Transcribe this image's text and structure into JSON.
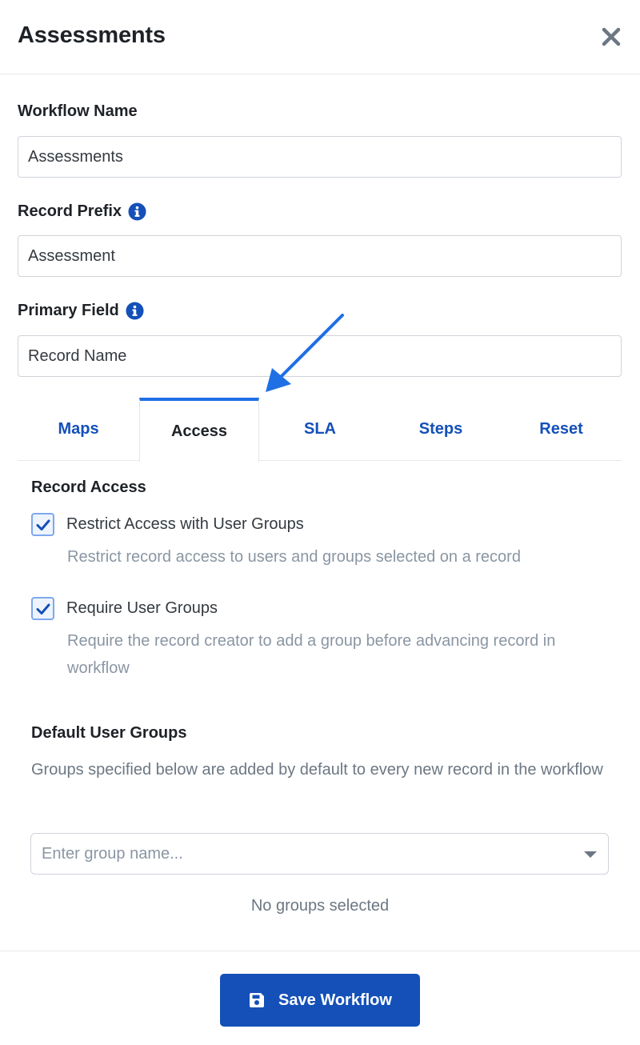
{
  "header": {
    "title": "Assessments",
    "close_icon": "close-icon"
  },
  "form": {
    "workflow_name": {
      "label": "Workflow Name",
      "value": "Assessments"
    },
    "record_prefix": {
      "label": "Record Prefix",
      "value": "Assessment",
      "info_icon": "info-icon"
    },
    "primary_field": {
      "label": "Primary Field",
      "value": "Record Name",
      "info_icon": "info-icon"
    }
  },
  "tabs": [
    {
      "label": "Maps",
      "active": false
    },
    {
      "label": "Access",
      "active": true
    },
    {
      "label": "SLA",
      "active": false
    },
    {
      "label": "Steps",
      "active": false
    },
    {
      "label": "Reset",
      "active": false
    }
  ],
  "access": {
    "section_title": "Record Access",
    "options": [
      {
        "label": "Restrict Access with User Groups",
        "help": "Restrict record access to users and groups selected on a record",
        "checked": true
      },
      {
        "label": "Require User Groups",
        "help": "Require the record creator to add a group before advancing record in workflow",
        "checked": true
      }
    ],
    "default_groups": {
      "title": "Default User Groups",
      "description": "Groups specified below are added by default to every new record in the workflow",
      "placeholder": "Enter group name...",
      "empty_text": "No groups selected"
    }
  },
  "footer": {
    "save_label": "Save Workflow",
    "save_icon": "floppy-disk-icon"
  },
  "colors": {
    "primary": "#1450b8",
    "active_tab_border": "#1f6fe5",
    "annotation_arrow": "#1f6fe5",
    "muted_text": "#8a96a3"
  }
}
